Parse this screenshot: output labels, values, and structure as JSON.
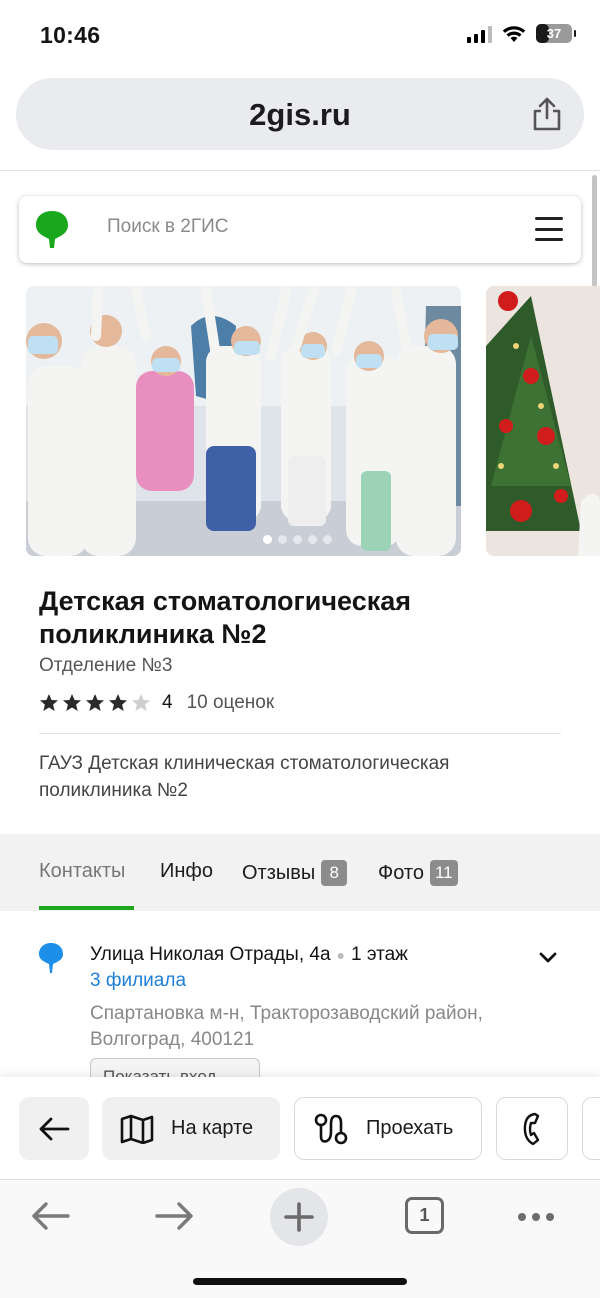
{
  "status_bar": {
    "time": "10:46",
    "battery": "37"
  },
  "browser": {
    "url": "2gis.ru",
    "open_tabs": "1"
  },
  "search": {
    "placeholder": "Поиск в 2ГИС"
  },
  "photos": {
    "count": 5,
    "active_index": 0
  },
  "place": {
    "name": "Детская стоматологическая поликлиника №2",
    "branch": "Отделение №3",
    "rating": {
      "value": "4",
      "stars": 4,
      "max_stars": 5,
      "reviews": "10 оценок"
    },
    "legal_name": "ГАУЗ Детская клиническая стоматологическая поликлиника №2"
  },
  "tabs": [
    {
      "label": "Контакты",
      "count": "",
      "active": true
    },
    {
      "label": "Инфо",
      "count": "",
      "active": false
    },
    {
      "label": "Отзывы",
      "count": "8",
      "active": false
    },
    {
      "label": "Фото",
      "count": "11",
      "active": false
    }
  ],
  "address": {
    "street": "Улица Николая Отрады, 4а",
    "floor": "1 этаж",
    "branches_link": "3 филиала",
    "district": "Спартановка м-н, Тракторозаводский район, Волгоград, 400121",
    "entrance_button": "Показать вход"
  },
  "actions": {
    "map_label": "На карте",
    "route_label": "Проехать"
  },
  "colors": {
    "accent_green": "#1da81f",
    "link_blue": "#1f7ed6",
    "pin_blue": "#1e8fe8",
    "logo_green": "#19a81c"
  }
}
